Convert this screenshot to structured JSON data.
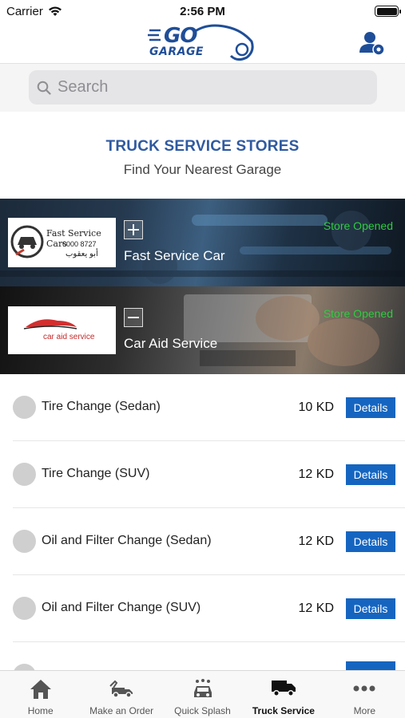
{
  "status_bar": {
    "carrier": "Carrier",
    "time": "2:56 PM"
  },
  "header": {
    "logo_top": "GO",
    "logo_bottom": "GARAGE"
  },
  "search": {
    "placeholder": "Search"
  },
  "section": {
    "title": "TRUCK SERVICE STORES",
    "subtitle": "Find Your Nearest Garage"
  },
  "stores": [
    {
      "name": "Fast Service Car",
      "status": "Store Opened",
      "logo_text": "Fast Service Cars",
      "logo_phone": "6000 8727",
      "logo_arabic": "أبو يعقوب",
      "expanded": false
    },
    {
      "name": "Car Aid Service",
      "status": "Store Opened",
      "logo_text": "car aid service",
      "expanded": true
    }
  ],
  "services": [
    {
      "name": "Tire Change (Sedan)",
      "price": "10 KD",
      "action": "Details"
    },
    {
      "name": "Tire Change (SUV)",
      "price": "12 KD",
      "action": "Details"
    },
    {
      "name": "Oil and Filter Change (Sedan)",
      "price": "12 KD",
      "action": "Details"
    },
    {
      "name": "Oil and Filter Change (SUV)",
      "price": "12 KD",
      "action": "Details"
    }
  ],
  "tab_bar": {
    "tabs": [
      {
        "label": "Home",
        "icon": "home-icon"
      },
      {
        "label": "Make an Order",
        "icon": "tow-truck-icon"
      },
      {
        "label": "Quick Splash",
        "icon": "car-wash-icon"
      },
      {
        "label": "Truck Service",
        "icon": "truck-icon",
        "active": true
      },
      {
        "label": "More",
        "icon": "more-icon"
      }
    ]
  },
  "colors": {
    "brand_blue": "#1f4e98",
    "title_blue": "#2f5aa0",
    "details_button": "#1565c0",
    "status_green": "#2ecc40"
  }
}
